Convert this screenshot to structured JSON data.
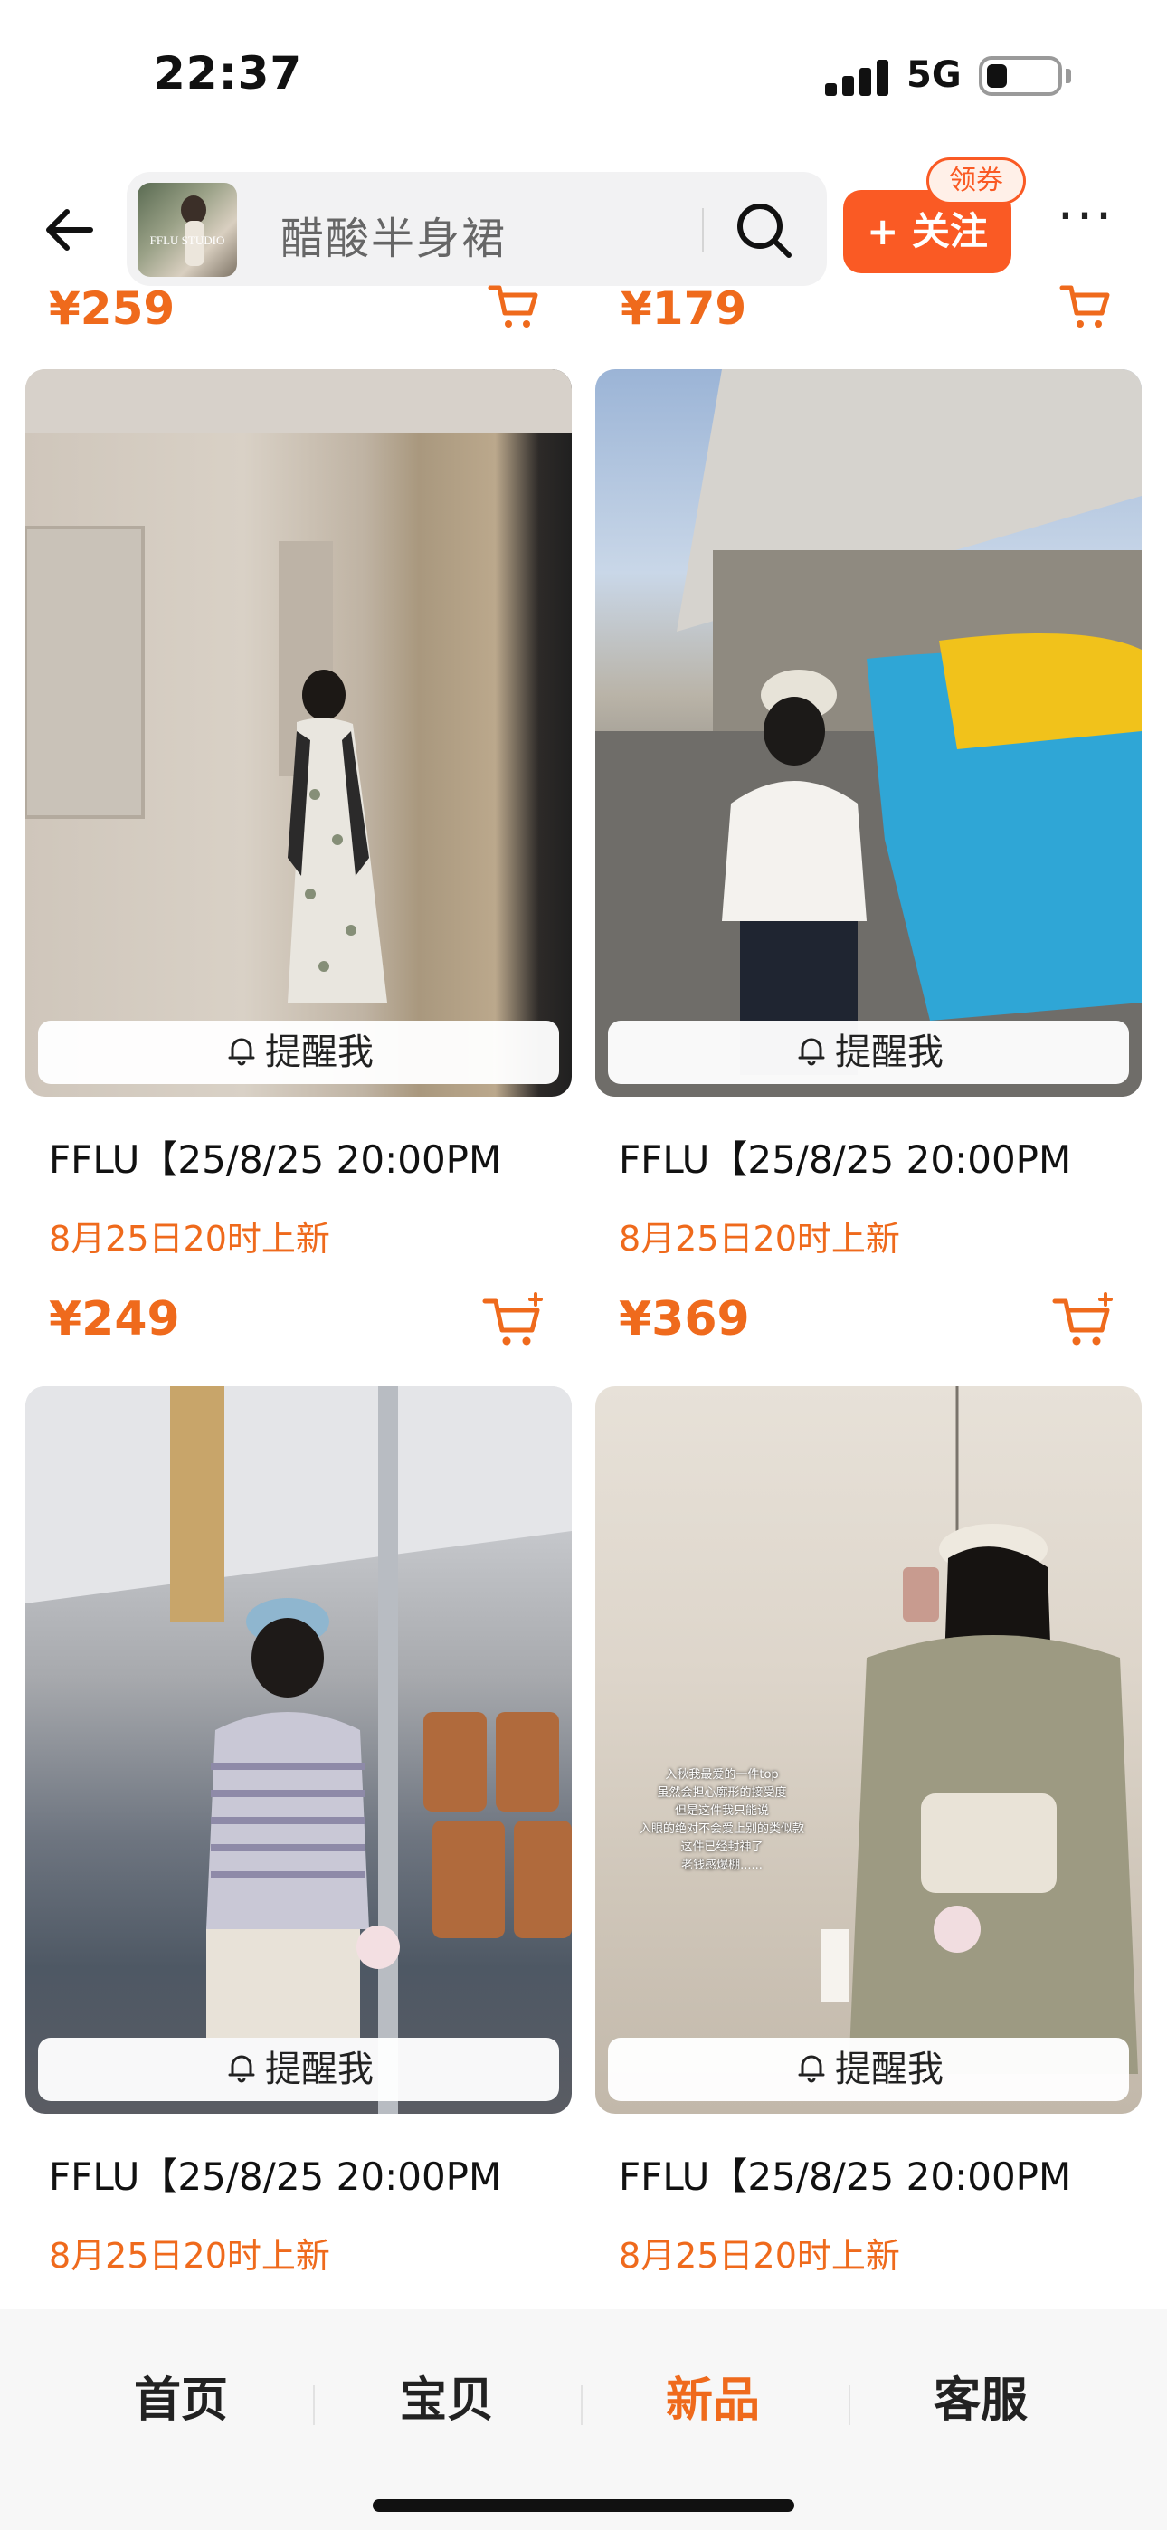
{
  "status_bar": {
    "time": "22:37",
    "network": "5G"
  },
  "header": {
    "search_text": "醋酸半身裙",
    "shop_logo_text": "FFLU STUDIO",
    "follow_label": "+ 关注",
    "coupon_label": "领券",
    "more_label": "···"
  },
  "partial_row": {
    "left_price": "¥259",
    "right_price": "¥179"
  },
  "products": [
    {
      "title": "FFLU【25/8/25 20:00PM",
      "subtitle": "8月25日20时上新",
      "remind": "提醒我",
      "price": "¥249"
    },
    {
      "title": "FFLU【25/8/25 20:00PM",
      "subtitle": "8月25日20时上新",
      "remind": "提醒我",
      "price": "¥369"
    },
    {
      "title": "FFLU【25/8/25 20:00PM",
      "subtitle": "8月25日20时上新",
      "remind": "提醒我",
      "price": ""
    },
    {
      "title": "FFLU【25/8/25 20:00PM",
      "subtitle": "8月25日20时上新",
      "remind": "提醒我",
      "price": ""
    }
  ],
  "photo_caption": [
    "入秋我最爱的一件top",
    "虽然会担心廓形的接受度",
    "但是这件我只能说",
    "入眼的绝对不会爱上别的类似款",
    "这件已经封神了",
    "老钱感爆棚......"
  ],
  "tabs": [
    {
      "label": "首页",
      "active": false
    },
    {
      "label": "宝贝",
      "active": false
    },
    {
      "label": "新品",
      "active": true
    },
    {
      "label": "客服",
      "active": false
    }
  ],
  "colors": {
    "accent": "#ef6a1c",
    "follow_button": "#fa5a24"
  },
  "icons": [
    "back-arrow-icon",
    "search-icon",
    "more-icon",
    "cart-icon",
    "bell-icon"
  ]
}
